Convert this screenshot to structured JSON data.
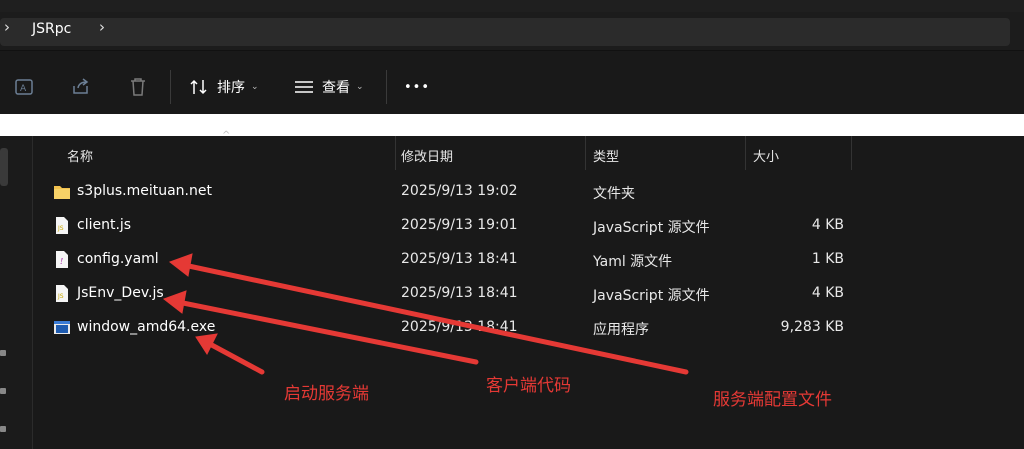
{
  "breadcrumb": {
    "current": "JSRpc"
  },
  "toolbar": {
    "sort_label": "排序",
    "view_label": "查看",
    "more_label": "•••"
  },
  "columns": {
    "name": "名称",
    "modified": "修改日期",
    "type": "类型",
    "size": "大小"
  },
  "files": [
    {
      "name": "s3plus.meituan.net",
      "modified": "2025/9/13 19:02",
      "type": "文件夹",
      "size": "",
      "icon": "folder-icon"
    },
    {
      "name": "client.js",
      "modified": "2025/9/13 19:01",
      "type": "JavaScript 源文件",
      "size": "4 KB",
      "icon": "js-file-icon"
    },
    {
      "name": "config.yaml",
      "modified": "2025/9/13 18:41",
      "type": "Yaml 源文件",
      "size": "1 KB",
      "icon": "yaml-file-icon"
    },
    {
      "name": "JsEnv_Dev.js",
      "modified": "2025/9/13 18:41",
      "type": "JavaScript 源文件",
      "size": "4 KB",
      "icon": "js-file-icon"
    },
    {
      "name": "window_amd64.exe",
      "modified": "2025/9/13 18:41",
      "type": "应用程序",
      "size": "9,283 KB",
      "icon": "exe-file-icon"
    }
  ],
  "annotations": {
    "start_server": "启动服务端",
    "client_code": "客户端代码",
    "server_config": "服务端配置文件",
    "color": "#e53935"
  }
}
